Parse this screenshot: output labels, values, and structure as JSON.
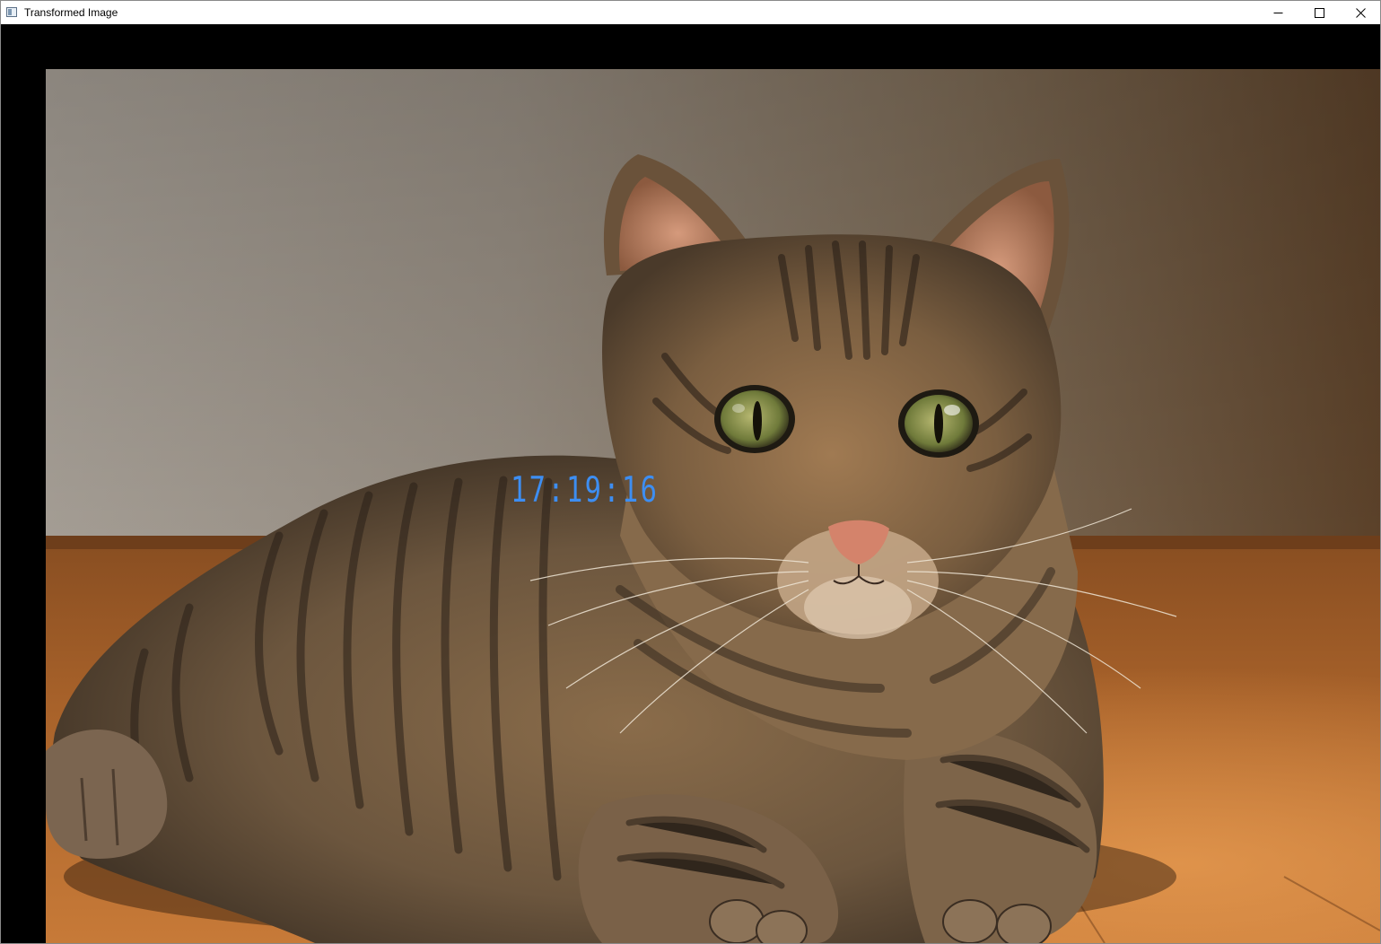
{
  "window": {
    "title": "Transformed Image",
    "controls": {
      "minimize_icon": "minimize-icon",
      "maximize_icon": "maximize-icon",
      "close_icon": "close-icon"
    }
  },
  "overlay": {
    "clock_text": "17:19:16",
    "clock_color": "#3d8ef2"
  },
  "image": {
    "subject_icon": "tabby-cat-photo"
  },
  "colors": {
    "client_background": "#000000",
    "titlebar_background": "#ffffff"
  }
}
